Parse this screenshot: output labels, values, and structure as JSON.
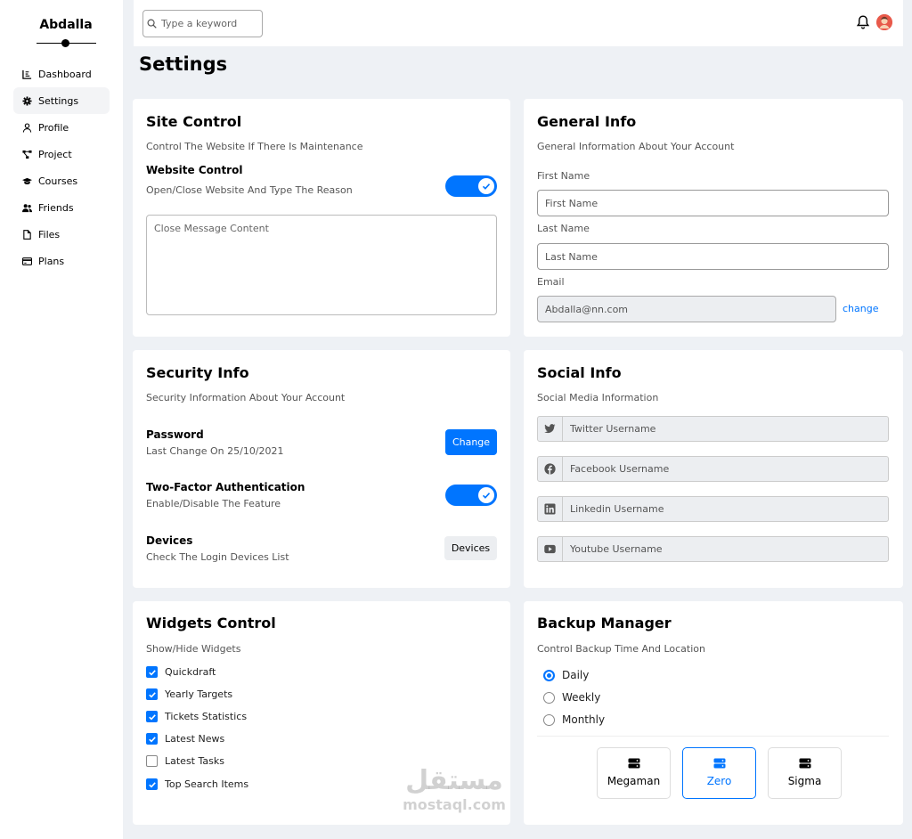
{
  "brand": {
    "name": "Abdalla"
  },
  "sidebar": {
    "items": [
      {
        "label": "Dashboard",
        "icon": "chart-icon"
      },
      {
        "label": "Settings",
        "icon": "gear-icon"
      },
      {
        "label": "Profile",
        "icon": "user-icon"
      },
      {
        "label": "Project",
        "icon": "diagram-icon"
      },
      {
        "label": "Courses",
        "icon": "graduation-cap-icon"
      },
      {
        "label": "Friends",
        "icon": "users-icon"
      },
      {
        "label": "Files",
        "icon": "file-icon"
      },
      {
        "label": "Plans",
        "icon": "credit-card-icon"
      }
    ],
    "active": "Settings"
  },
  "header": {
    "search_placeholder": "Type a keyword"
  },
  "page": {
    "title": "Settings"
  },
  "site_control": {
    "title": "Site Control",
    "subtitle": "Control The Website If There Is Maintenance",
    "row_title": "Website Control",
    "row_sub": "Open/Close Website And Type The Reason",
    "toggle_on": true,
    "message_placeholder": "Close Message Content"
  },
  "general_info": {
    "title": "General Info",
    "subtitle": "General Information About Your Account",
    "first_name_label": "First Name",
    "first_name_placeholder": "First Name",
    "last_name_label": "Last Name",
    "last_name_placeholder": "Last Name",
    "email_label": "Email",
    "email_value": "Abdalla@nn.com",
    "change_link": "change"
  },
  "security_info": {
    "title": "Security Info",
    "subtitle": "Security Information About Your Account",
    "password_title": "Password",
    "password_sub": "Last Change On 25/10/2021",
    "change_button": "Change",
    "twofa_title": "Two-Factor Authentication",
    "twofa_sub": "Enable/Disable The Feature",
    "twofa_on": true,
    "devices_title": "Devices",
    "devices_sub": "Check The Login Devices List",
    "devices_button": "Devices"
  },
  "social_info": {
    "title": "Social Info",
    "subtitle": "Social Media Information",
    "fields": [
      {
        "icon": "twitter-icon",
        "placeholder": "Twitter Username"
      },
      {
        "icon": "facebook-icon",
        "placeholder": "Facebook Username"
      },
      {
        "icon": "linkedin-icon",
        "placeholder": "Linkedin Username"
      },
      {
        "icon": "youtube-icon",
        "placeholder": "Youtube Username"
      }
    ]
  },
  "widgets_control": {
    "title": "Widgets Control",
    "subtitle": "Show/Hide Widgets",
    "items": [
      {
        "label": "Quickdraft",
        "checked": true
      },
      {
        "label": "Yearly Targets",
        "checked": true
      },
      {
        "label": "Tickets Statistics",
        "checked": true
      },
      {
        "label": "Latest News",
        "checked": true
      },
      {
        "label": "Latest Tasks",
        "checked": false
      },
      {
        "label": "Top Search Items",
        "checked": true
      }
    ]
  },
  "backup_manager": {
    "title": "Backup Manager",
    "subtitle": "Control Backup Time And Location",
    "options": [
      {
        "label": "Daily",
        "selected": true
      },
      {
        "label": "Weekly",
        "selected": false
      },
      {
        "label": "Monthly",
        "selected": false
      }
    ],
    "servers": [
      {
        "label": "Megaman",
        "selected": false
      },
      {
        "label": "Zero",
        "selected": true
      },
      {
        "label": "Sigma",
        "selected": false
      }
    ]
  },
  "watermark": {
    "arabic": "مستقل",
    "latin": "mostaql.com"
  },
  "colors": {
    "accent": "#0075ff",
    "background": "#eef1f5"
  }
}
